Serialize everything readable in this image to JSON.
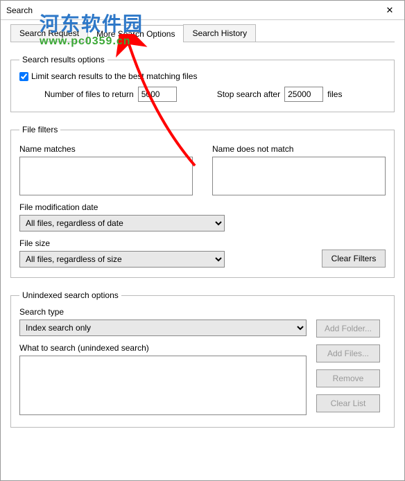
{
  "window": {
    "title": "Search",
    "close": "✕"
  },
  "tabs": {
    "request": "Search Request",
    "more": "More Search Options",
    "history": "Search History"
  },
  "results": {
    "legend": "Search results options",
    "limit_label": "Limit search results to the best matching files",
    "limit_checked": true,
    "num_label": "Number of files to return",
    "num_value": "5000",
    "stop_label": "Stop search after",
    "stop_value": "25000",
    "files_suffix": "files"
  },
  "filters": {
    "legend": "File filters",
    "name_matches_label": "Name matches",
    "name_matches_value": "",
    "name_not_label": "Name does not match",
    "name_not_value": "",
    "mod_date_label": "File modification date",
    "mod_date_value": "All files, regardless of date",
    "size_label": "File size",
    "size_value": "All files, regardless of size",
    "clear_btn": "Clear Filters"
  },
  "unindexed": {
    "legend": "Unindexed search options",
    "type_label": "Search type",
    "type_value": "Index search only",
    "what_label": "What to search (unindexed search)",
    "what_value": "",
    "add_folder": "Add Folder...",
    "add_files": "Add Files...",
    "remove": "Remove",
    "clear_list": "Clear List"
  },
  "watermark": {
    "cn": "河东软件园",
    "url": "www.pc0359.cn"
  }
}
